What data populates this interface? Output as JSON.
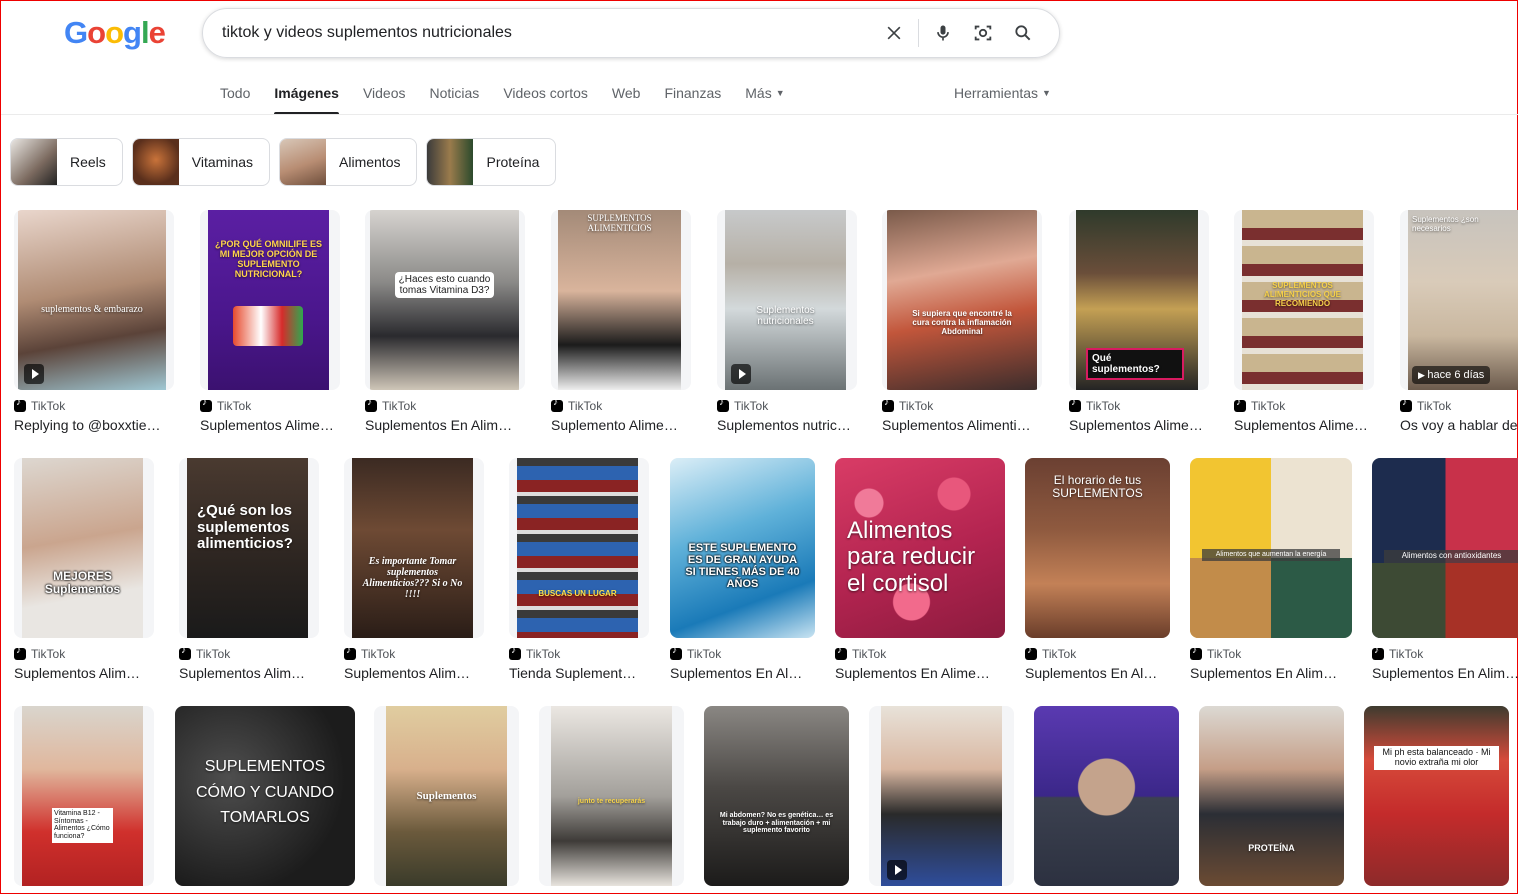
{
  "logo": [
    "G",
    "o",
    "o",
    "g",
    "l",
    "e"
  ],
  "search": {
    "value": "tiktok y videos suplementos nutricionales"
  },
  "tabs": [
    "Todo",
    "Imágenes",
    "Videos",
    "Noticias",
    "Videos cortos",
    "Web",
    "Finanzas",
    "Más"
  ],
  "tools_label": "Herramientas",
  "chips": [
    "Reels",
    "Vitaminas",
    "Alimentos",
    "Proteína"
  ],
  "colors": {
    "blue": "#4285f4",
    "red": "#ea4335",
    "yellow": "#fbbc05",
    "green": "#34a853"
  },
  "results": [
    {
      "src": "TikTok",
      "cap": "Replying to @boxxtie…",
      "img": "suplementos & embarazo",
      "play": true
    },
    {
      "src": "TikTok",
      "cap": "Suplementos Alime…",
      "img": "¿POR QUÉ OMNILIFE ES MI MEJOR OPCIÓN DE SUPLEMENTO NUTRICIONAL?"
    },
    {
      "src": "TikTok",
      "cap": "Suplementos En Alim…",
      "img": "¿Haces esto cuando tomas Vitamina D3?"
    },
    {
      "src": "TikTok",
      "cap": "Suplemento Alime…",
      "img": "SUPLEMENTOS ALIMENTICIOS"
    },
    {
      "src": "TikTok",
      "cap": "Suplementos nutric…",
      "img": "Suplementos nutricionales",
      "play": true
    },
    {
      "src": "TikTok",
      "cap": "Suplementos Alimenti…",
      "img": "Si supiera que encontré la cura contra la inflamación Abdominal"
    },
    {
      "src": "TikTok",
      "cap": "Suplementos Alime…",
      "img": "Qué suplementos?"
    },
    {
      "src": "TikTok",
      "cap": "Suplementos Alime…",
      "img": "SUPLEMENTOS ALIMENTICIOS QUE RECOMIENDO"
    },
    {
      "src": "TikTok",
      "cap": "Os voy a hablar de",
      "img": "Suplementos ¿son necesarios",
      "age": "hace 6 días"
    },
    {
      "src": "TikTok",
      "cap": "Suplementos Alim…",
      "img": "MEJORES Suplementos"
    },
    {
      "src": "TikTok",
      "cap": "Suplementos Alim…",
      "img": "¿Qué son los suplementos alimenticios?"
    },
    {
      "src": "TikTok",
      "cap": "Suplementos Alim…",
      "img": "Es importante Tomar suplementos Alimenticios??? Si o No !!!!"
    },
    {
      "src": "TikTok",
      "cap": "Tienda Suplement…",
      "img": "BUSCAS UN LUGAR"
    },
    {
      "src": "TikTok",
      "cap": "Suplementos En Al…",
      "img": "ESTE SUPLEMENTO ES DE GRAN AYUDA SI TIENES MÁS DE 40 AÑOS"
    },
    {
      "src": "TikTok",
      "cap": "Suplementos En Alime…",
      "img": "Alimentos para reducir el cortisol"
    },
    {
      "src": "TikTok",
      "cap": "Suplementos En Al…",
      "img": "El horario de tus SUPLEMENTOS"
    },
    {
      "src": "TikTok",
      "cap": "Suplementos En Alim…",
      "img": "Alimentos que aumentan la energía"
    },
    {
      "src": "TikTok",
      "cap": "Suplementos En Alim…",
      "img": "Alimentos con antioxidantes"
    },
    {
      "img": "Vitamina B12 -Síntomas -Alimentos ¿Cómo funciona?"
    },
    {
      "img": "SUPLEMENTOS CÓMO Y CUANDO TOMARLOS"
    },
    {
      "img": "Suplementos"
    },
    {
      "img": "junto te recuperarás"
    },
    {
      "img": "Mi abdomen? No es genética… es trabajo duro + alimentación + mi suplemento favorito"
    },
    {
      "img": "",
      "play": true
    },
    {
      "img": ""
    },
    {
      "img": "PROTEÍNA"
    },
    {
      "img": "Mi ph esta balanceado · Mi novio extraña mi olor"
    }
  ]
}
